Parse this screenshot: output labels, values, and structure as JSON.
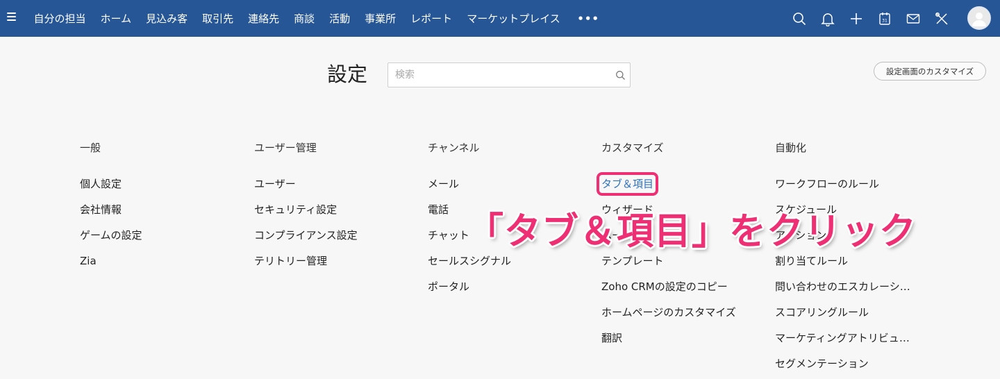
{
  "nav": {
    "items": [
      "自分の担当",
      "ホーム",
      "見込み客",
      "取引先",
      "連絡先",
      "商談",
      "活動",
      "事業所",
      "レポート",
      "マーケットプレイス"
    ],
    "more": "•••"
  },
  "page": {
    "title": "設定",
    "search_placeholder": "検索",
    "customize_label": "設定画面のカスタマイズ"
  },
  "columns": [
    {
      "header": "一般",
      "items": [
        "個人設定",
        "会社情報",
        "ゲームの設定",
        "Zia"
      ]
    },
    {
      "header": "ユーザー管理",
      "items": [
        "ユーザー",
        "セキュリティ設定",
        "コンプライアンス設定",
        "テリトリー管理"
      ]
    },
    {
      "header": "チャンネル",
      "items": [
        "メール",
        "電話",
        "チャット",
        "セールスシグナル",
        "ポータル"
      ]
    },
    {
      "header": "カスタマイズ",
      "items": [
        "タブ＆項目",
        "ウィザード",
        "ページ",
        "テンプレート",
        "Zoho CRMの設定のコピー",
        "ホームページのカスタマイズ",
        "翻訳"
      ]
    },
    {
      "header": "自動化",
      "items": [
        "ワークフローのルール",
        "スケジュール",
        "アクション",
        "割り当てルール",
        "問い合わせのエスカレーション",
        "スコアリングルール",
        "マーケティングアトリビューション",
        "セグメンテーション"
      ]
    }
  ],
  "annotation": "「タブ＆項目」をクリック",
  "colors": {
    "nav_bg": "#265695",
    "highlight": "#ee2f74",
    "link": "#2f72c0"
  }
}
